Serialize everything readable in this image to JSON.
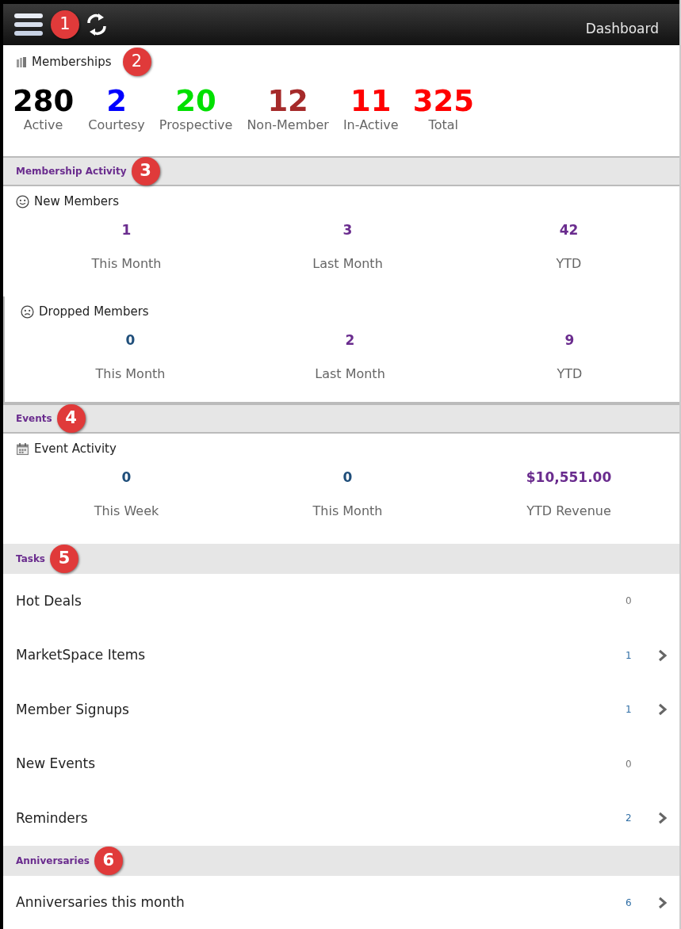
{
  "app_bar": {
    "title": "Dashboard",
    "callout": "1"
  },
  "memberships": {
    "title": "Memberships",
    "callout": "2",
    "stats": [
      {
        "value": "280",
        "label": "Active",
        "color": "#000000"
      },
      {
        "value": "2",
        "label": "Courtesy",
        "color": "#0000ff"
      },
      {
        "value": "20",
        "label": "Prospective",
        "color": "#00e000"
      },
      {
        "value": "12",
        "label": "Non-Member",
        "color": "#a52a2a"
      },
      {
        "value": "11",
        "label": "In-Active",
        "color": "#ff0000"
      },
      {
        "value": "325",
        "label": "Total",
        "color": "#ff0000"
      }
    ]
  },
  "sections": [
    {
      "title": "Membership Activity",
      "callout": "3",
      "panels": [
        {
          "title": "New Members",
          "kind": "smile",
          "boxed": false,
          "metrics": [
            {
              "value": "1",
              "label": "This Month",
              "color": "#6a2c8e"
            },
            {
              "value": "3",
              "label": "Last Month",
              "color": "#6a2c8e"
            },
            {
              "value": "42",
              "label": "YTD",
              "color": "#6a2c8e"
            }
          ]
        },
        {
          "title": "Dropped Members",
          "kind": "frown",
          "boxed": true,
          "metrics": [
            {
              "value": "0",
              "label": "This Month",
              "color": "#1f4e7a"
            },
            {
              "value": "2",
              "label": "Last Month",
              "color": "#6a2c8e"
            },
            {
              "value": "9",
              "label": "YTD",
              "color": "#6a2c8e"
            }
          ]
        }
      ]
    },
    {
      "title": "Events",
      "callout": "4",
      "panels": [
        {
          "title": "Event Activity",
          "kind": "calendar",
          "boxed": false,
          "metrics": [
            {
              "value": "0",
              "label": "This Week",
              "color": "#1f4e7a"
            },
            {
              "value": "0",
              "label": "This Month",
              "color": "#1f4e7a"
            },
            {
              "value": "$10,551.00",
              "label": "YTD Revenue",
              "color": "#6a2c8e"
            }
          ]
        }
      ]
    },
    {
      "title": "Tasks",
      "callout": "5",
      "rows": [
        {
          "label": "Hot Deals",
          "count": "0",
          "expandable": false
        },
        {
          "label": "MarketSpace Items",
          "count": "1",
          "expandable": true
        },
        {
          "label": "Member Signups",
          "count": "1",
          "expandable": true
        },
        {
          "label": "New Events",
          "count": "0",
          "expandable": false
        },
        {
          "label": "Reminders",
          "count": "2",
          "expandable": true
        }
      ]
    },
    {
      "title": "Anniversaries",
      "callout": "6",
      "rows": [
        {
          "label": "Anniversaries this month",
          "count": "6",
          "expandable": true
        }
      ]
    }
  ]
}
